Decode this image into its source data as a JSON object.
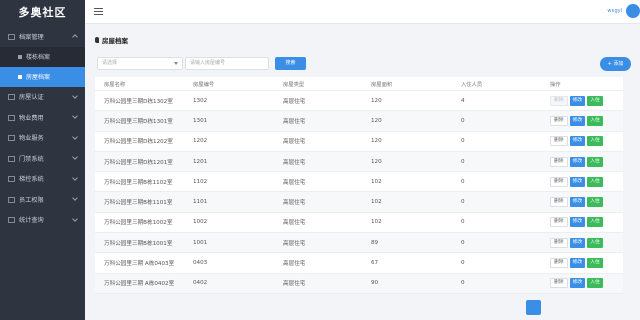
{
  "app": {
    "name": "多奥社区"
  },
  "header": {
    "user": "wxgyl"
  },
  "sidebar": {
    "items": [
      {
        "label": "档案管理",
        "icon": "folder-icon",
        "expanded": true,
        "children": [
          {
            "label": "楼栋档案",
            "active": false
          },
          {
            "label": "房屋档案",
            "active": true
          }
        ]
      },
      {
        "label": "房屋认证",
        "icon": "home-icon"
      },
      {
        "label": "物业费用",
        "icon": "money-icon"
      },
      {
        "label": "物业服务",
        "icon": "service-icon"
      },
      {
        "label": "门禁系统",
        "icon": "door-icon"
      },
      {
        "label": "梯控系统",
        "icon": "elevator-icon"
      },
      {
        "label": "员工权限",
        "icon": "staff-icon"
      },
      {
        "label": "统计查询",
        "icon": "stats-icon"
      }
    ]
  },
  "page": {
    "title": "房屋档案"
  },
  "filters": {
    "select_placeholder": "请选择",
    "input_placeholder": "请输入房屋编号",
    "search_label": "搜索",
    "add_label": "+ 添加"
  },
  "table": {
    "columns": [
      "房屋名称",
      "房屋编号",
      "房屋类型",
      "房屋面积",
      "入住人员",
      "操作"
    ],
    "actions": {
      "delete": "删除",
      "edit": "修改",
      "checkin": "入住"
    },
    "rows": [
      {
        "name": "万科公园里三期D栋1302室",
        "number": "1302",
        "type": "高层住宅",
        "area": "120",
        "residents": "4",
        "delete_disabled": true
      },
      {
        "name": "万科公园里三期D栋1301室",
        "number": "1301",
        "type": "高层住宅",
        "area": "120",
        "residents": "0"
      },
      {
        "name": "万科公园里三期D栋1202室",
        "number": "1202",
        "type": "高层住宅",
        "area": "120",
        "residents": "0"
      },
      {
        "name": "万科公园里三期D栋1201室",
        "number": "1201",
        "type": "高层住宅",
        "area": "120",
        "residents": "0"
      },
      {
        "name": "万科公园里三期B栋1102室",
        "number": "1102",
        "type": "高层住宅",
        "area": "102",
        "residents": "0"
      },
      {
        "name": "万科公园里三期B栋1101室",
        "number": "1101",
        "type": "高层住宅",
        "area": "102",
        "residents": "0"
      },
      {
        "name": "万科公园里三期B栋1002室",
        "number": "1002",
        "type": "高层住宅",
        "area": "102",
        "residents": "0"
      },
      {
        "name": "万科公园里三期B栋1001室",
        "number": "1001",
        "type": "高层住宅",
        "area": "89",
        "residents": "0"
      },
      {
        "name": "万科公园里三期 A栋0403室",
        "number": "0403",
        "type": "高层住宅",
        "area": "67",
        "residents": "0"
      },
      {
        "name": "万科公园里三期 A栋0402室",
        "number": "0402",
        "type": "高层住宅",
        "area": "90",
        "residents": "0"
      }
    ]
  }
}
